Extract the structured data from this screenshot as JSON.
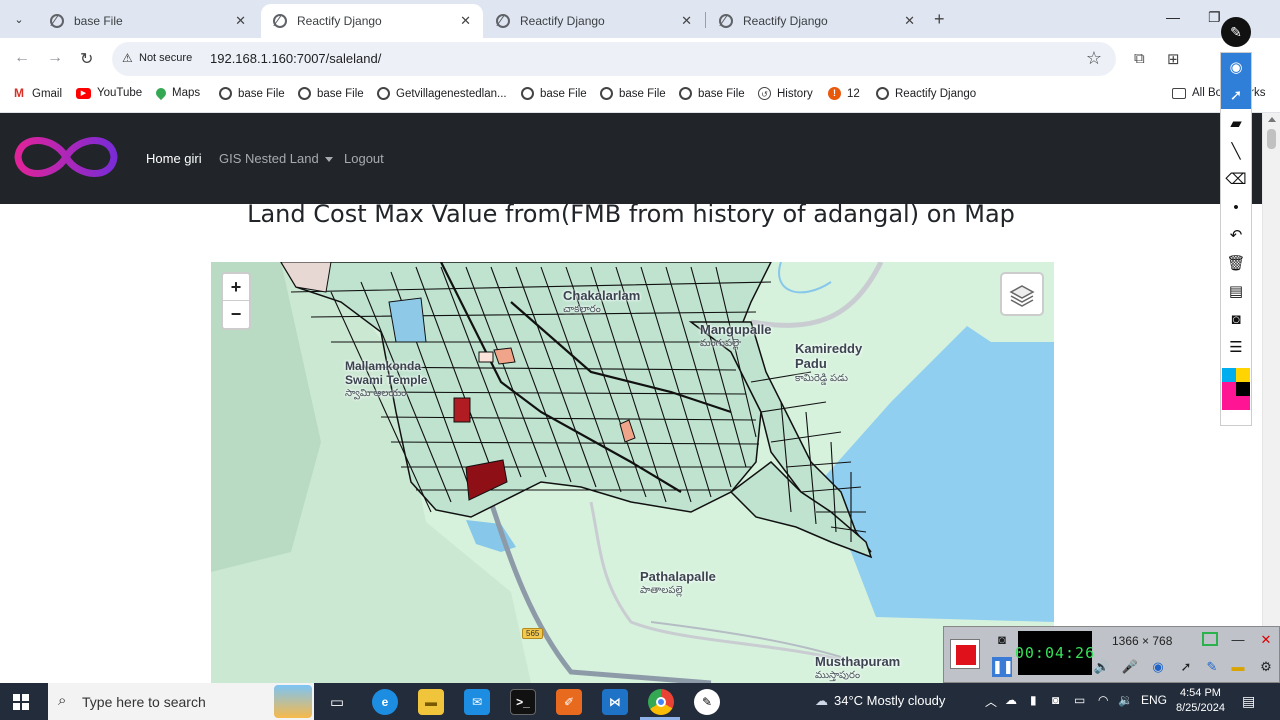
{
  "browser": {
    "tabs": [
      {
        "title": "base File",
        "active": false
      },
      {
        "title": "Reactify Django",
        "active": true
      },
      {
        "title": "Reactify Django",
        "active": false
      },
      {
        "title": "Reactify Django",
        "active": false
      }
    ],
    "address": {
      "security_label": "Not secure",
      "url": "192.168.1.160:7007/saleland/"
    },
    "bookmarks": [
      "Gmail",
      "YouTube",
      "Maps",
      "base File",
      "base File",
      "Getvillagenestedlan...",
      "base File",
      "base File",
      "base File",
      "History",
      "12",
      "Reactify Django"
    ],
    "all_bookmarks": "All Bookmarks"
  },
  "site": {
    "nav": {
      "brand": "Home giri",
      "dropdown": "GIS Nested Land",
      "logout": "Logout"
    },
    "heading": "Land Cost Max Value from(FMB from history of adangal) on Map"
  },
  "map": {
    "zoom_in": "+",
    "zoom_out": "−",
    "labels": [
      {
        "en": "Chakalarlam",
        "te": "చాకలారం"
      },
      {
        "en": "Mangupalle",
        "te": "మంగుపల్లె"
      },
      {
        "en": "Kamireddy Padu",
        "te": "కామిరెడ్డి పడు"
      },
      {
        "en": "Mallamkonda Swami Temple",
        "te": "స్వామి ఆలయం"
      },
      {
        "en": "Pathalapalle",
        "te": "పాతాలపల్లె"
      },
      {
        "en": "Musthapuram",
        "te": "ముస్తాపురం"
      }
    ],
    "road_sign": "565",
    "colors": {
      "parcel_fill": "#bfe3cf",
      "parcel_stroke": "#111111",
      "water": "#8fd1ee",
      "forest": "#b7d8c0",
      "max_value": "#b11b22",
      "mid_value": "#f0a58a"
    }
  },
  "recorder": {
    "time": "00:04:26",
    "resolution": "1366 × 768"
  },
  "taskbar": {
    "search_placeholder": "Type here to search",
    "weather": "34°C  Mostly cloudy",
    "lang": "ENG",
    "time": "4:54 PM",
    "date": "8/25/2024"
  }
}
